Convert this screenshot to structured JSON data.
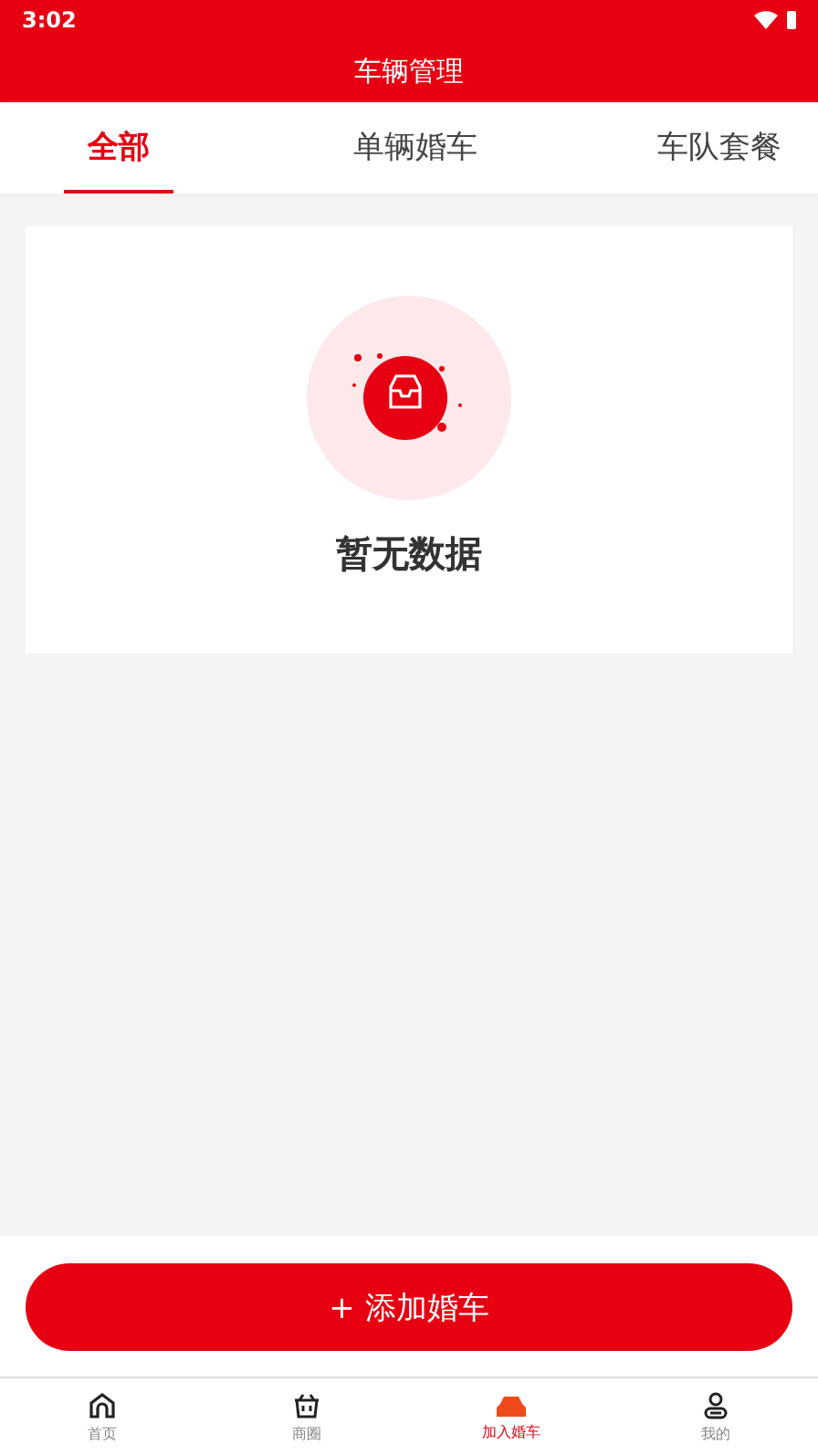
{
  "status_bar": {
    "time": "3:02"
  },
  "header": {
    "title": "车辆管理"
  },
  "tabs": [
    {
      "label": "全部",
      "selected": true
    },
    {
      "label": "单辆婚车",
      "selected": false
    },
    {
      "label": "车队套餐",
      "selected": false
    }
  ],
  "empty_state": {
    "message": "暂无数据"
  },
  "add_button": {
    "label": "+ 添加婚车"
  },
  "bottom_nav": [
    {
      "label": "首页",
      "kind": "home",
      "selected": false
    },
    {
      "label": "商圈",
      "kind": "basket",
      "selected": false
    },
    {
      "label": "加入婚车",
      "kind": "car",
      "selected": true
    },
    {
      "label": "我的",
      "kind": "person",
      "selected": false
    }
  ]
}
